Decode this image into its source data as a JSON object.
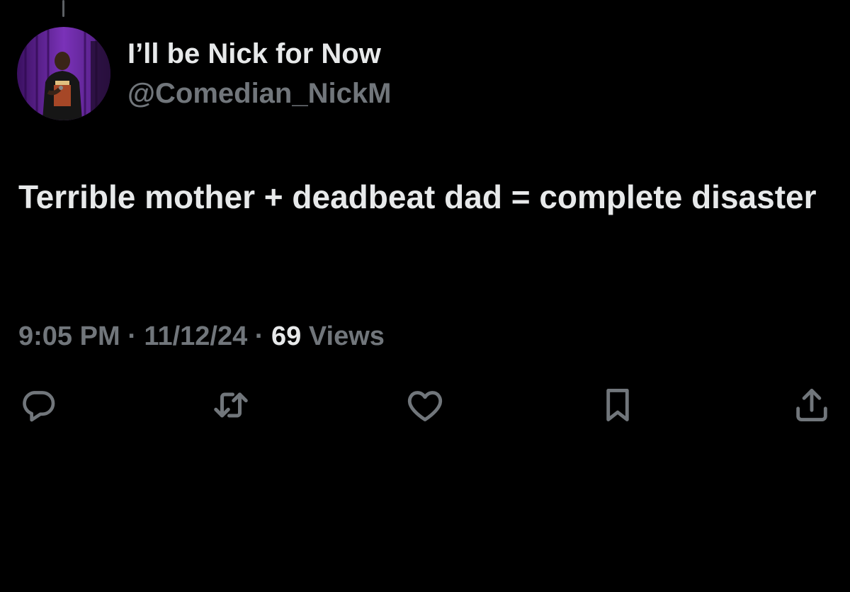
{
  "tweet": {
    "author": {
      "display_name": "I’ll be Nick for Now",
      "handle": "@Comedian_NickM"
    },
    "text": "Terrible mother + deadbeat dad = complete disaster",
    "meta": {
      "time": "9:05 PM",
      "separator": "·",
      "date": "11/12/24",
      "views_count": "69",
      "views_label": "Views"
    }
  },
  "actions": [
    {
      "name": "reply",
      "icon": "reply-icon"
    },
    {
      "name": "retweet",
      "icon": "retweet-icon"
    },
    {
      "name": "like",
      "icon": "heart-icon"
    },
    {
      "name": "bookmark",
      "icon": "bookmark-icon"
    },
    {
      "name": "share",
      "icon": "share-icon"
    }
  ],
  "colors": {
    "background": "#000000",
    "primary_text": "#e7e9ea",
    "secondary_text": "#71767b",
    "avatar_backdrop": "#6a2fa0"
  }
}
